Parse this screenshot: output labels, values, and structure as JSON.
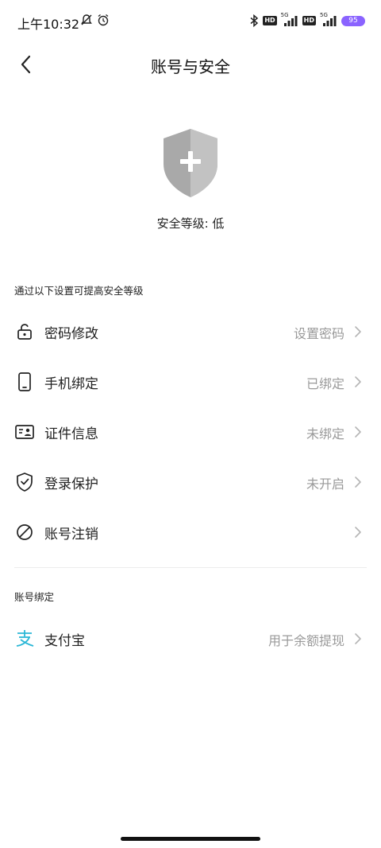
{
  "status_bar": {
    "time": "上午10:32",
    "hd1": "HD",
    "hd2": "HD",
    "net1": "5G",
    "net2": "5G",
    "battery": "95"
  },
  "nav": {
    "title": "账号与安全"
  },
  "security": {
    "level_text": "安全等级: 低"
  },
  "sections": {
    "improve_title": "通过以下设置可提高安全等级",
    "binding_title": "账号绑定"
  },
  "rows": [
    {
      "label": "密码修改",
      "value": "设置密码",
      "icon": "lock-icon"
    },
    {
      "label": "手机绑定",
      "value": "已绑定",
      "icon": "phone-icon"
    },
    {
      "label": "证件信息",
      "value": "未绑定",
      "icon": "id-card-icon"
    },
    {
      "label": "登录保护",
      "value": "未开启",
      "icon": "shield-check-icon"
    },
    {
      "label": "账号注销",
      "value": "",
      "icon": "ban-icon"
    }
  ],
  "binding_rows": [
    {
      "label": "支付宝",
      "value": "用于余额提现",
      "icon": "alipay-icon"
    }
  ],
  "colors": {
    "alipay": "#2bb7d6",
    "shield": "#a9a9a9",
    "muted": "#9a9a9a"
  }
}
